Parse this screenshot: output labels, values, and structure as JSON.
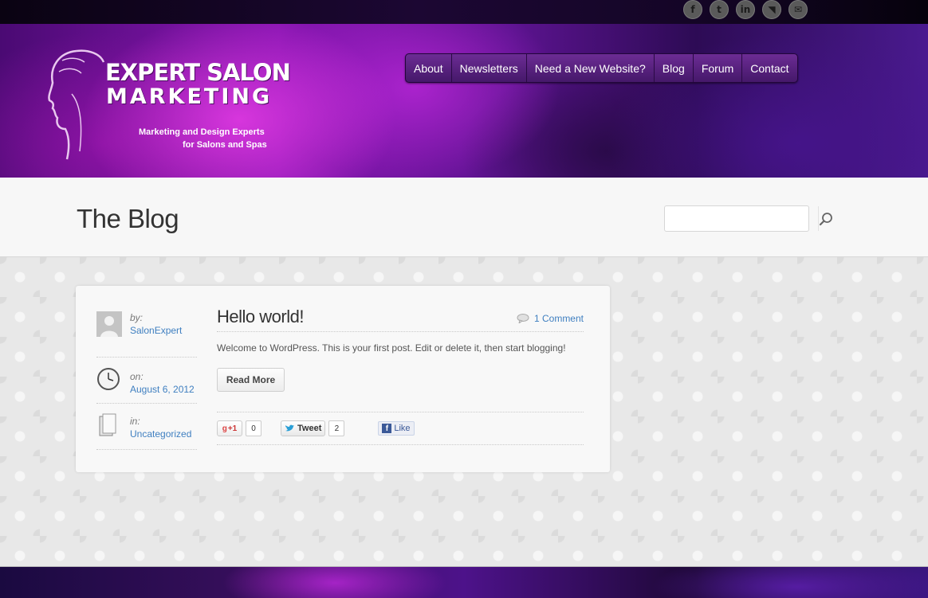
{
  "social": [
    {
      "name": "facebook-icon",
      "glyph": "f"
    },
    {
      "name": "twitter-icon",
      "glyph": "t"
    },
    {
      "name": "linkedin-icon",
      "glyph": "in"
    },
    {
      "name": "rss-icon",
      "glyph": "◥"
    },
    {
      "name": "email-icon",
      "glyph": "✉"
    }
  ],
  "logo": {
    "line1": "EXPERT SALON",
    "line2": "MARKETING",
    "tagline1": "Marketing and Design Experts",
    "tagline2": "for Salons and Spas"
  },
  "nav": [
    "About",
    "Newsletters",
    "Need a New Website?",
    "Blog",
    "Forum",
    "Contact"
  ],
  "page": {
    "title": "The Blog"
  },
  "search": {
    "placeholder": "",
    "value": ""
  },
  "post": {
    "title": "Hello world!",
    "comments": "1 Comment",
    "excerpt": "Welcome to WordPress. This is your first post. Edit or delete it, then start blogging!",
    "read_more": "Read More",
    "meta": {
      "author_label": "by:",
      "author": "SalonExpert",
      "date_label": "on:",
      "date": "August 6, 2012",
      "category_label": "in:",
      "category": "Uncategorized"
    },
    "share": {
      "gplus_label": "+1",
      "gplus_count": "0",
      "tweet_label": "Tweet",
      "tweet_count": "2",
      "like_label": "Like"
    }
  },
  "colors": {
    "accent_link": "#3f7fc0",
    "nav_bg": "#5a2080",
    "header_purple": "#8a16b3"
  }
}
